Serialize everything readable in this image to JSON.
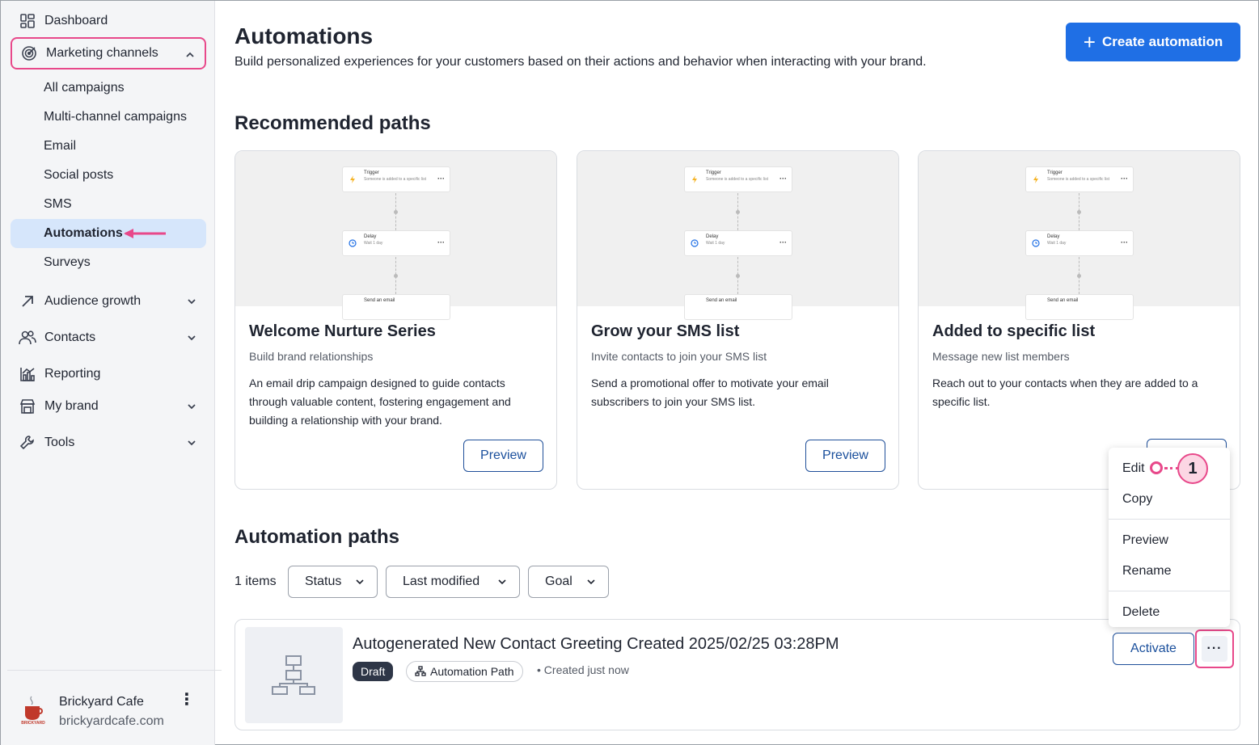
{
  "sidebar": {
    "dashboard": "Dashboard",
    "marketing_channels": "Marketing channels",
    "sub_items": [
      "All campaigns",
      "Multi-channel campaigns",
      "Email",
      "Social posts",
      "SMS",
      "Automations",
      "Surveys"
    ],
    "audience_growth": "Audience growth",
    "contacts": "Contacts",
    "reporting": "Reporting",
    "my_brand": "My brand",
    "tools": "Tools",
    "account_name": "Brickyard Cafe",
    "account_url": "brickyardcafe.com",
    "logo_text": "BRICKYARD"
  },
  "header": {
    "title": "Automations",
    "subtitle": "Build personalized experiences for your customers based on their actions and behavior when interacting with your brand.",
    "create_button": "Create automation"
  },
  "recommended": {
    "title": "Recommended paths",
    "thumb": {
      "trigger": "Trigger",
      "trigger_sub": "Someone is added to a specific list",
      "delay": "Delay",
      "delay_sub": "Wait 1 day",
      "send": "Send an email"
    },
    "cards": [
      {
        "title": "Welcome Nurture Series",
        "subtitle": "Build brand relationships",
        "description": "An email drip campaign designed to guide contacts through valuable content, fostering engagement and building a relationship with your brand.",
        "button": "Preview"
      },
      {
        "title": "Grow your SMS list",
        "subtitle": "Invite contacts to join your SMS list",
        "description": "Send a promotional offer to motivate your email subscribers to join your SMS list.",
        "button": "Preview"
      },
      {
        "title": "Added to specific list",
        "subtitle": "Message new list members",
        "description": "Reach out to your contacts when they are added to a specific list.",
        "button": "Preview"
      }
    ]
  },
  "paths": {
    "title": "Automation paths",
    "count": "1 items",
    "filters": [
      "Status",
      "Last modified",
      "Goal"
    ],
    "row": {
      "title": "Autogenerated New Contact Greeting Created 2025/02/25 03:28PM",
      "status": "Draft",
      "type": "Automation Path",
      "created": "Created just now",
      "activate": "Activate",
      "more": "···"
    }
  },
  "menu": {
    "items": [
      "Edit",
      "Copy",
      "Preview",
      "Rename",
      "Delete"
    ],
    "callout": "1"
  },
  "colors": {
    "primary": "#1f6fe5",
    "highlight": "#e8488a",
    "active_bg": "#d6e6fb"
  }
}
